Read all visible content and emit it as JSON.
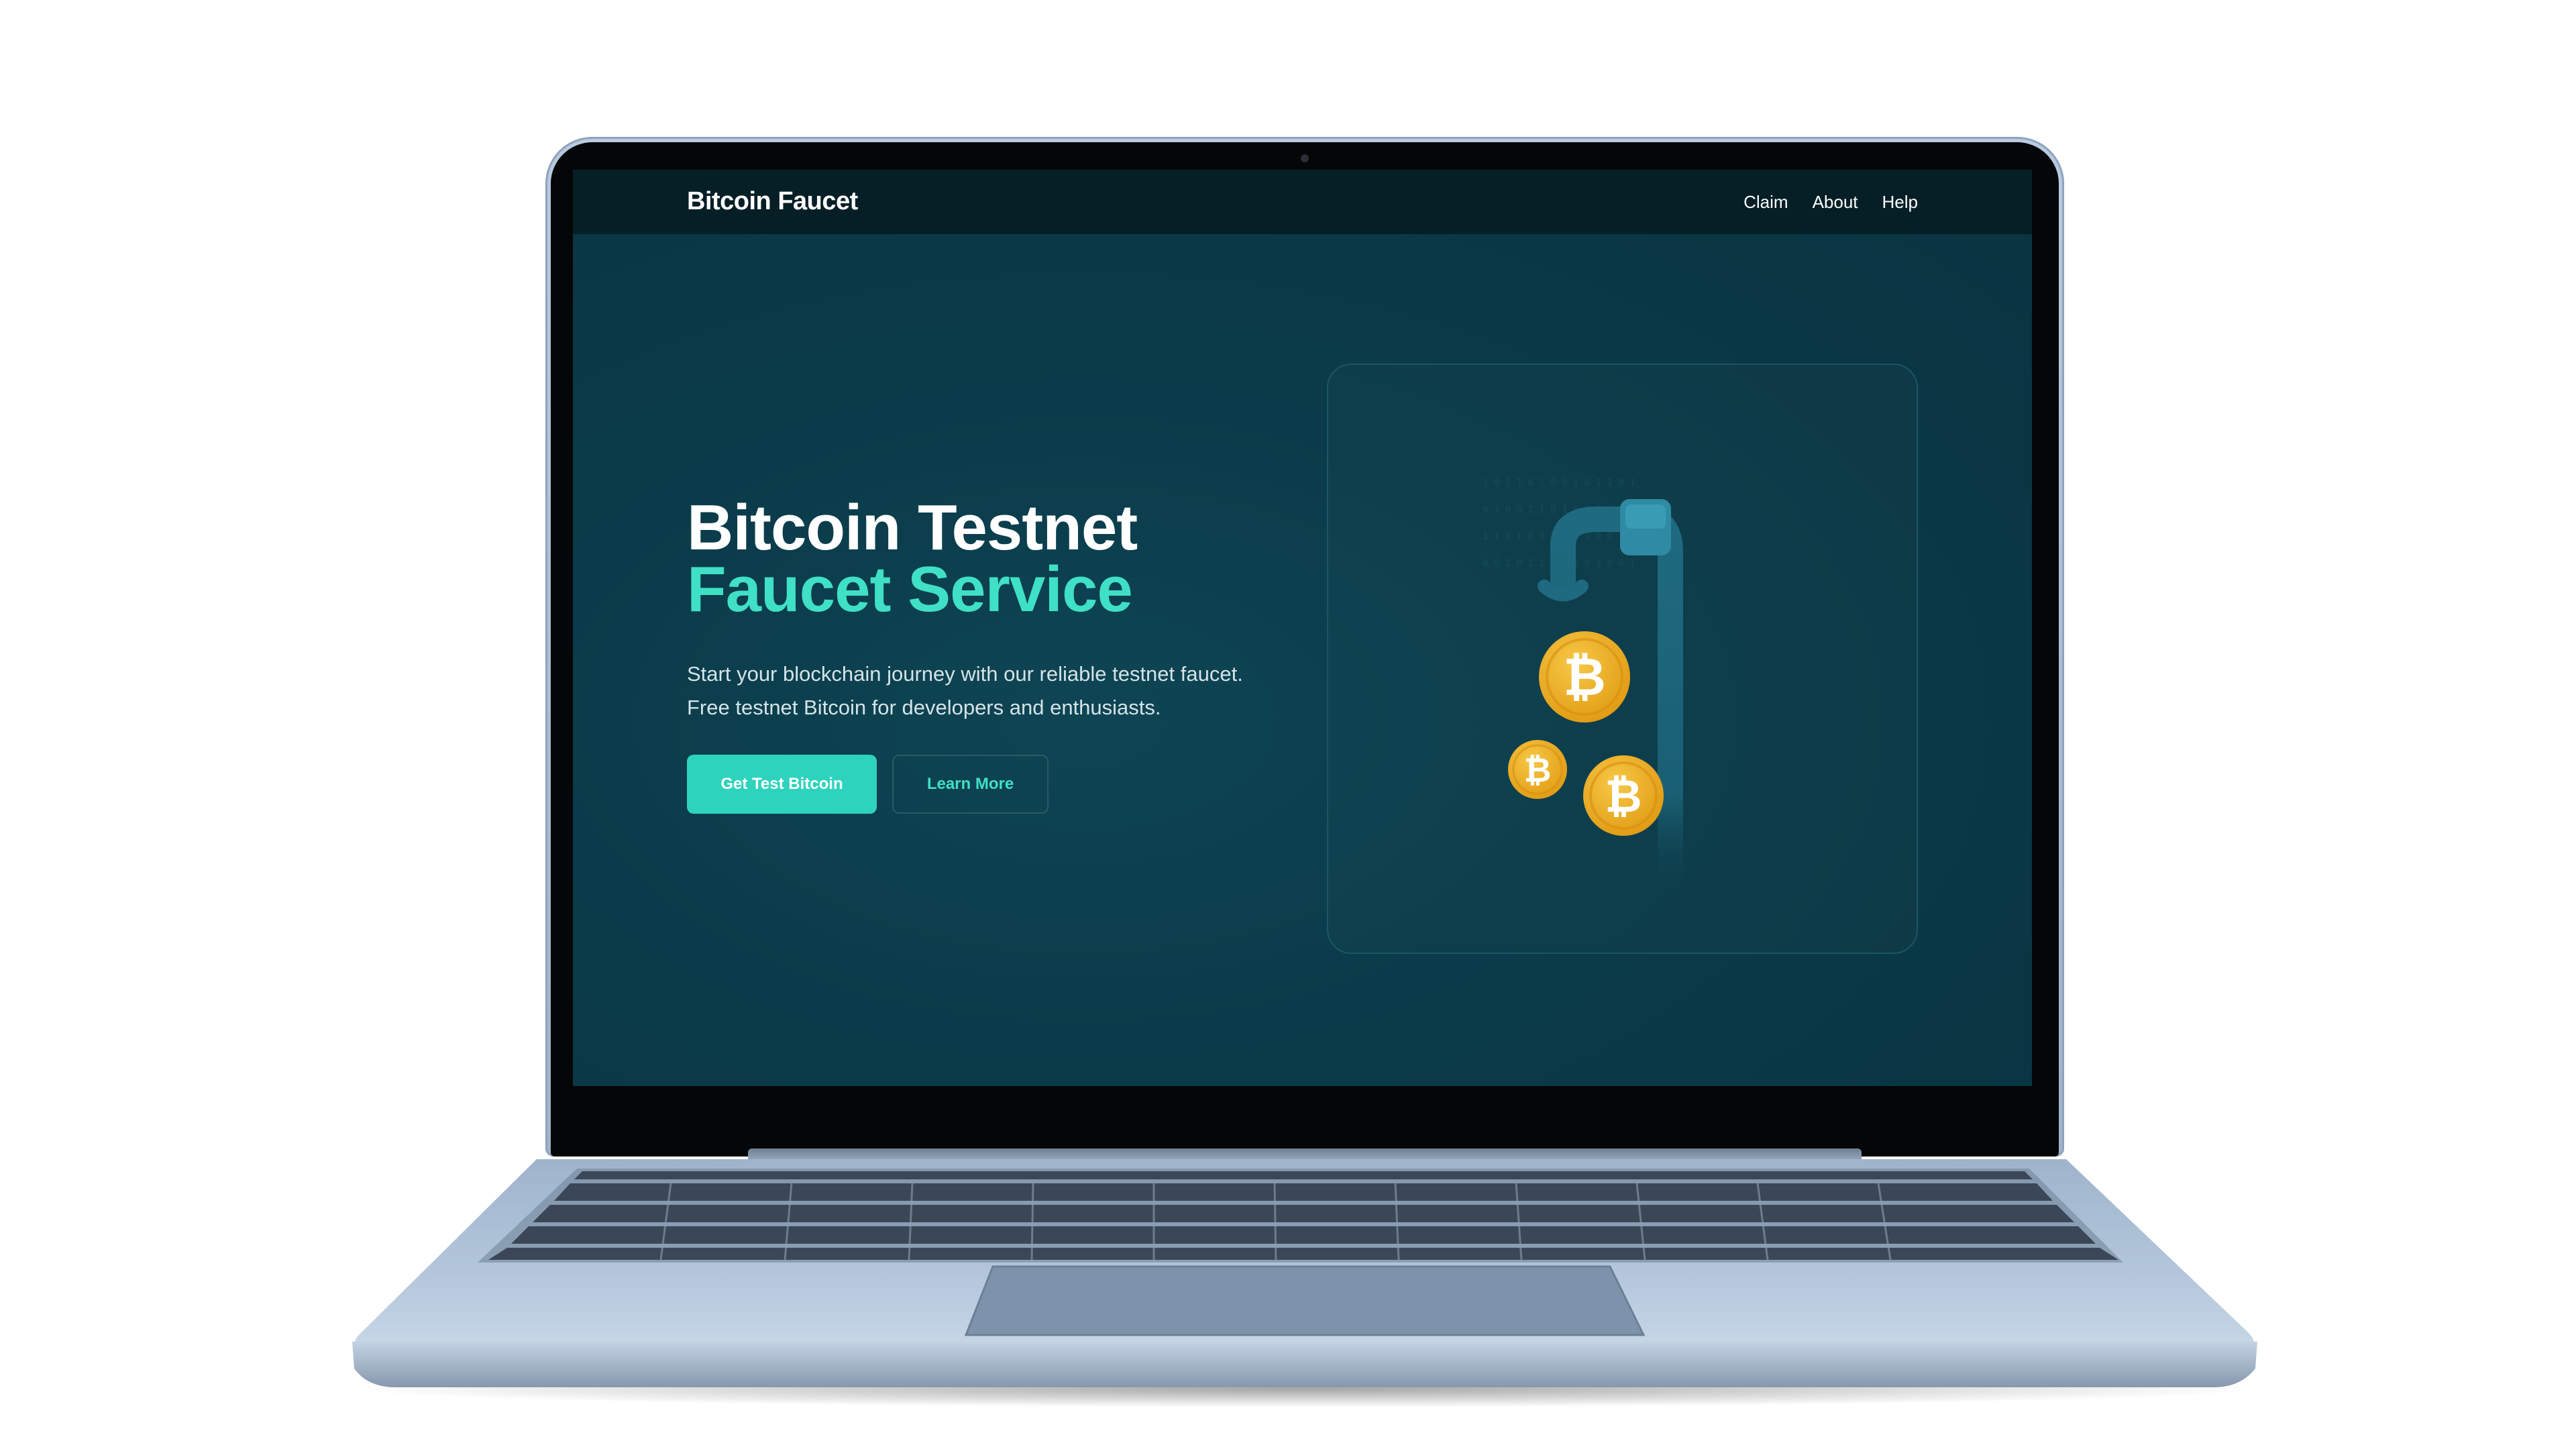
{
  "site": {
    "brand": "Bitcoin Faucet",
    "nav": [
      {
        "label": "Claim"
      },
      {
        "label": "About"
      },
      {
        "label": "Help"
      }
    ]
  },
  "hero": {
    "title_line1": "Bitcoin Testnet",
    "title_line2": "Faucet Service",
    "subtitle_line1": "Start your blockchain journey with our reliable testnet faucet.",
    "subtitle_line2": "Free testnet Bitcoin for developers and enthusiasts.",
    "primary_button": "Get Test Bitcoin",
    "secondary_button": "Learn More"
  },
  "illustration": {
    "icons": [
      "faucet-icon",
      "bitcoin-coin-icon"
    ],
    "coin_symbol": "₿"
  },
  "colors": {
    "page_background": "#0b3b4a",
    "header_background": "#061f26",
    "accent": "#3fe0c5",
    "button_primary": "#2ed3bd",
    "coin_gold": "#f0b41f",
    "laptop_body": "#a9bdd4"
  }
}
